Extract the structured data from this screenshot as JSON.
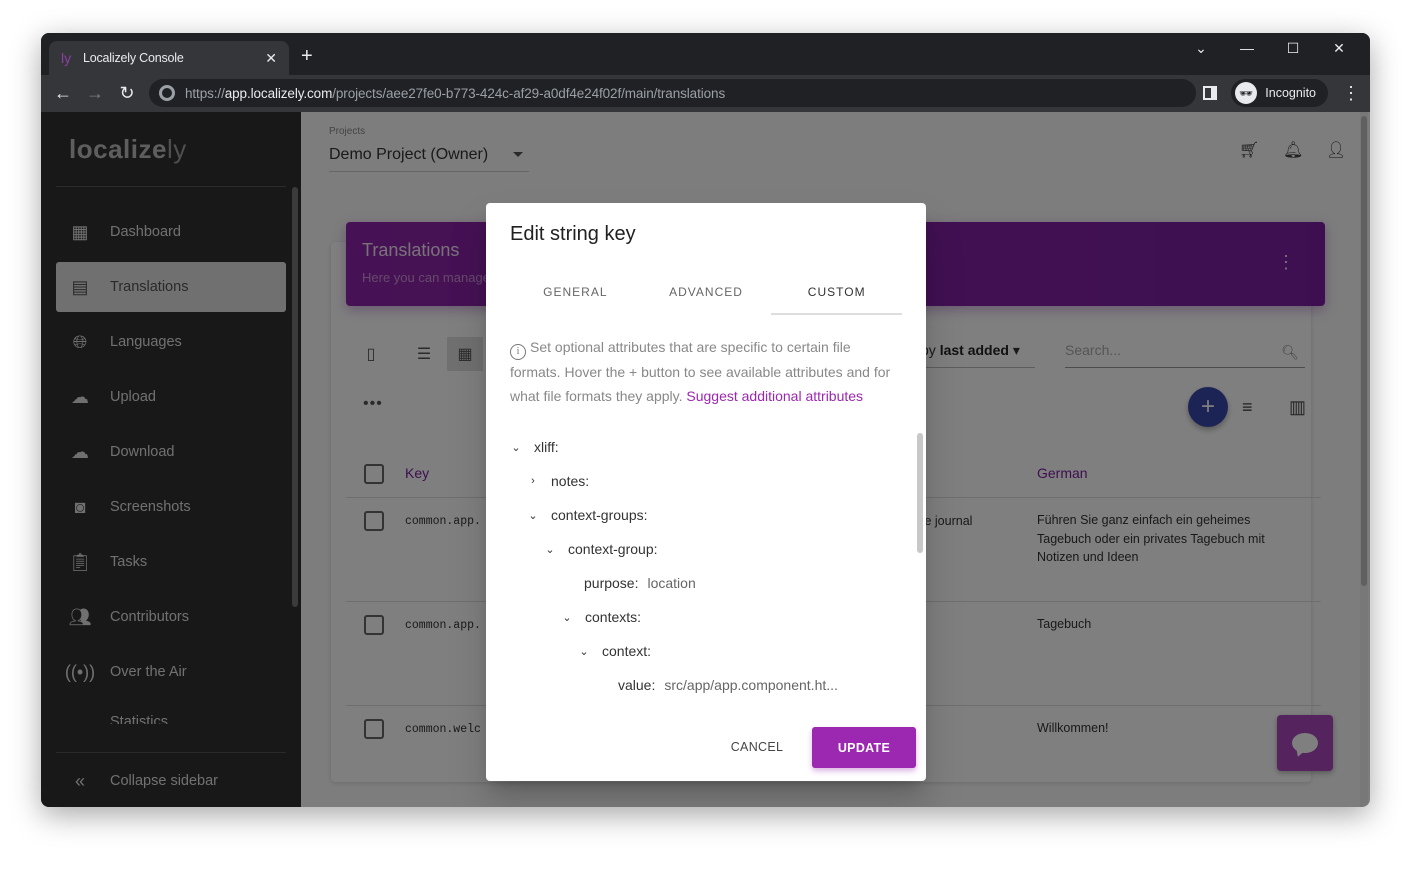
{
  "browser": {
    "tab_title": "Localizely Console",
    "tab_favicon": "ly",
    "url_scheme": "https://",
    "url_host": "app.localizely.com",
    "url_path": "/projects/aee27fe0-b773-424c-af29-a0df4e24f02f/main/translations",
    "profile_label": "Incognito"
  },
  "sidebar": {
    "logo_main": "localize",
    "logo_suffix": "ly",
    "items": [
      {
        "label": "Dashboard",
        "icon": "dashboard-icon",
        "active": false
      },
      {
        "label": "Translations",
        "icon": "translations-icon",
        "active": true
      },
      {
        "label": "Languages",
        "icon": "globe-icon",
        "active": false
      },
      {
        "label": "Upload",
        "icon": "cloud-upload-icon",
        "active": false
      },
      {
        "label": "Download",
        "icon": "cloud-download-icon",
        "active": false
      },
      {
        "label": "Screenshots",
        "icon": "camera-icon",
        "active": false
      },
      {
        "label": "Tasks",
        "icon": "clipboard-icon",
        "active": false
      },
      {
        "label": "Contributors",
        "icon": "people-icon",
        "active": false
      },
      {
        "label": "Over the Air",
        "icon": "antenna-icon",
        "active": false
      },
      {
        "label": "Statistics",
        "icon": "chart-icon",
        "active": false
      }
    ],
    "collapse_label": "Collapse sidebar"
  },
  "header": {
    "project_label": "Projects",
    "project_value": "Demo Project (Owner)"
  },
  "banner": {
    "title": "Translations",
    "subtitle": "Here you can manage"
  },
  "toolbar": {
    "sort_prefix": "by",
    "sort_value": "last added",
    "search_placeholder": "Search..."
  },
  "table": {
    "col_key": "Key",
    "col_german": "German",
    "rows": [
      {
        "key": "common.app.",
        "source": "te journal",
        "german": "Führen Sie ganz einfach ein geheimes Tagebuch oder ein privates Tagebuch mit Notizen und Ideen"
      },
      {
        "key": "common.app.",
        "source": "",
        "german": "Tagebuch"
      },
      {
        "key": "common.welc",
        "source": "",
        "german": "Willkommen!"
      }
    ]
  },
  "dialog": {
    "title": "Edit string key",
    "tabs": [
      "GENERAL",
      "ADVANCED",
      "CUSTOM"
    ],
    "active_tab": "CUSTOM",
    "info_text": "Set optional attributes that are specific to certain file formats. Hover the + button to see available attributes and for what file formats they apply.",
    "info_link": "Suggest additional attributes",
    "tree": [
      {
        "label": "xliff:",
        "toggle": "expanded",
        "depth": 0
      },
      {
        "label": "notes:",
        "toggle": "collapsed",
        "depth": 1
      },
      {
        "label": "context-groups:",
        "toggle": "expanded",
        "depth": 1
      },
      {
        "label": "context-group:",
        "toggle": "expanded",
        "depth": 2
      },
      {
        "label": "purpose:",
        "value": "location",
        "toggle": "none",
        "depth": 3
      },
      {
        "label": "contexts:",
        "toggle": "expanded",
        "depth": 3
      },
      {
        "label": "context:",
        "toggle": "expanded",
        "depth": 4
      },
      {
        "label": "value:",
        "value": "src/app/app.component.ht...",
        "toggle": "none",
        "depth": 5
      }
    ],
    "cancel_label": "CANCEL",
    "update_label": "UPDATE"
  },
  "colors": {
    "accent": "#9c27b0",
    "banner": "#8e24aa",
    "fab": "#3949ab",
    "chat": "#ab47bc"
  }
}
